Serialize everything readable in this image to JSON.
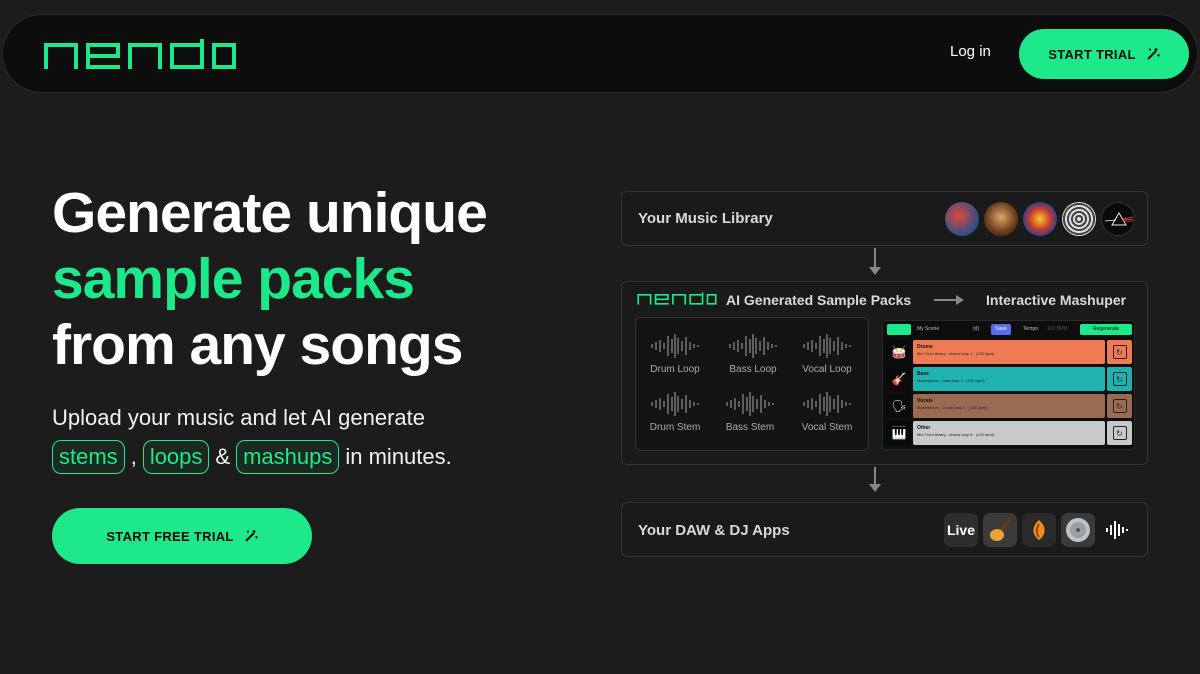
{
  "nav": {
    "logo_alt": "nendo",
    "login": "Log in",
    "trial": "START TRIAL"
  },
  "hero": {
    "line1": "Generate unique",
    "line2": "sample packs",
    "line3": "from any songs",
    "sub1": "Upload your music and let AI generate",
    "pill1": "stems",
    "comma": ",",
    "pill2": "loops",
    "amp": "&",
    "pill3": "mashups",
    "tail": "in minutes.",
    "cta": "START FREE TRIAL"
  },
  "diagram": {
    "library_title": "Your Music Library",
    "gen_title": "AI Generated Sample Packs",
    "mashuper_title": "Interactive Mashuper",
    "samples": [
      "Drum Loop",
      "Bass Loop",
      "Vocal Loop",
      "Drum Stem",
      "Bass Stem",
      "Vocal Stem"
    ],
    "mashuper": {
      "scene": "My Scene",
      "bars": "(d)",
      "save": "Save",
      "tempo": "Tempo",
      "bpm": "120 BPM",
      "regenerate": "Regenerate",
      "tracks": [
        {
          "name": "Drums",
          "desc": "Mix From library - drums loop 1 · (120 bpm)",
          "color": "#ef7b55"
        },
        {
          "name": "Bass",
          "desc": "Masterpiece - bass loop 4 · (120 bpm)",
          "color": "#1fb3b0"
        },
        {
          "name": "Vocals",
          "desc": "Masterpiece - vocals loop 1 · (120 bpm)",
          "color": "#9a6a52"
        },
        {
          "name": "Other",
          "desc": "Mix From library - drums loop 8 · (120 bpm)",
          "color": "#c7c9cc"
        }
      ]
    },
    "daw_title": "Your DAW & DJ Apps",
    "apps": [
      "Live",
      "guitar",
      "fruity",
      "disc",
      "wave"
    ]
  },
  "colors": {
    "accent": "#1de98b",
    "bg": "#1c1c1c"
  }
}
